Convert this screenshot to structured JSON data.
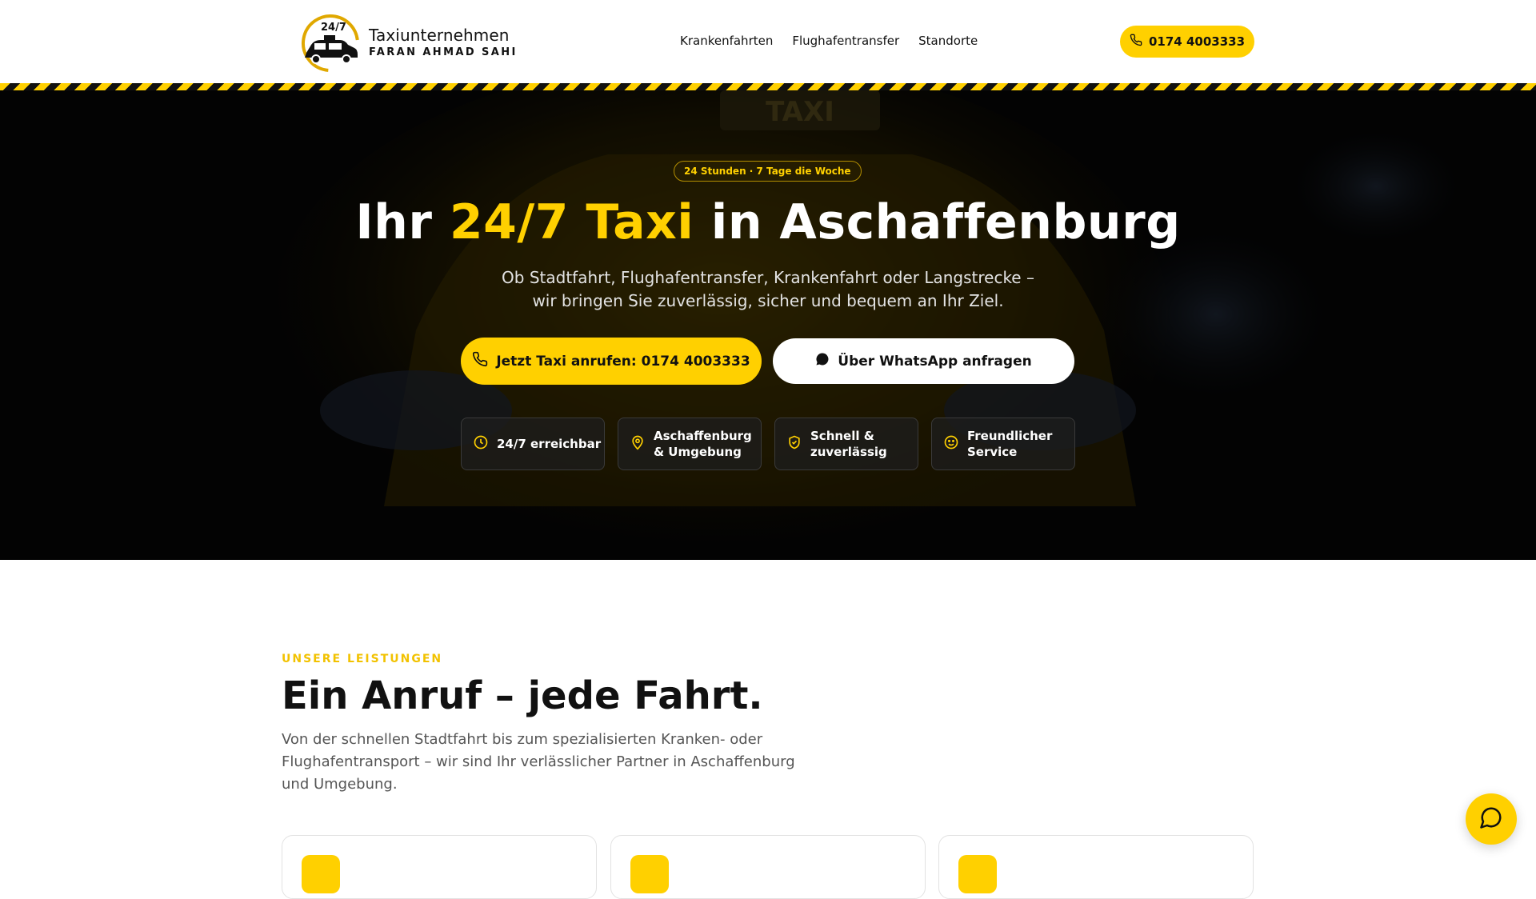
{
  "brand": {
    "badge_text": "24/7",
    "title": "Taxiunternehmen",
    "subtitle": "FARAN AHMAD SAHI"
  },
  "nav": [
    {
      "label": "Krankenfahrten"
    },
    {
      "label": "Flughafentransfer"
    },
    {
      "label": "Standorte"
    }
  ],
  "header_phone": {
    "label": "0174 4003333",
    "icon": "phone-icon"
  },
  "hero": {
    "badge": "24 Stunden · 7 Tage die Woche",
    "title_pre": "Ihr ",
    "title_highlight": "24/7 Taxi",
    "title_post": " in Aschaffenburg",
    "subtitle_line1": "Ob Stadtfahrt, Flughafentransfer, Krankenfahrt oder Langstrecke –",
    "subtitle_line2": "wir bringen Sie zuverlässig, sicher und bequem an Ihr Ziel.",
    "sign_text": "TAXI",
    "cta_call": "Jetzt Taxi anrufen: 0174 4003333",
    "cta_whatsapp": "Über WhatsApp anfragen",
    "features": [
      {
        "line1": "24/7 erreichbar",
        "line2": "",
        "icon": "clock-icon"
      },
      {
        "line1": "Aschaffenburg",
        "line2": "& Umgebung",
        "icon": "map-pin-icon"
      },
      {
        "line1": "Schnell &",
        "line2": "zuverlässig",
        "icon": "shield-check-icon"
      },
      {
        "line1": "Freundlicher",
        "line2": "Service",
        "icon": "smile-icon"
      }
    ]
  },
  "services": {
    "eyebrow": "UNSERE LEISTUNGEN",
    "title": "Ein Anruf – jede Fahrt.",
    "text": "Von der schnellen Stadtfahrt bis zum spezialisierten Kranken- oder Flughafentransport – wir sind Ihr verlässlicher Partner in Aschaffenburg und Umgebung."
  },
  "colors": {
    "accent": "#ffd000",
    "dark": "#050505",
    "text": "#111111"
  }
}
